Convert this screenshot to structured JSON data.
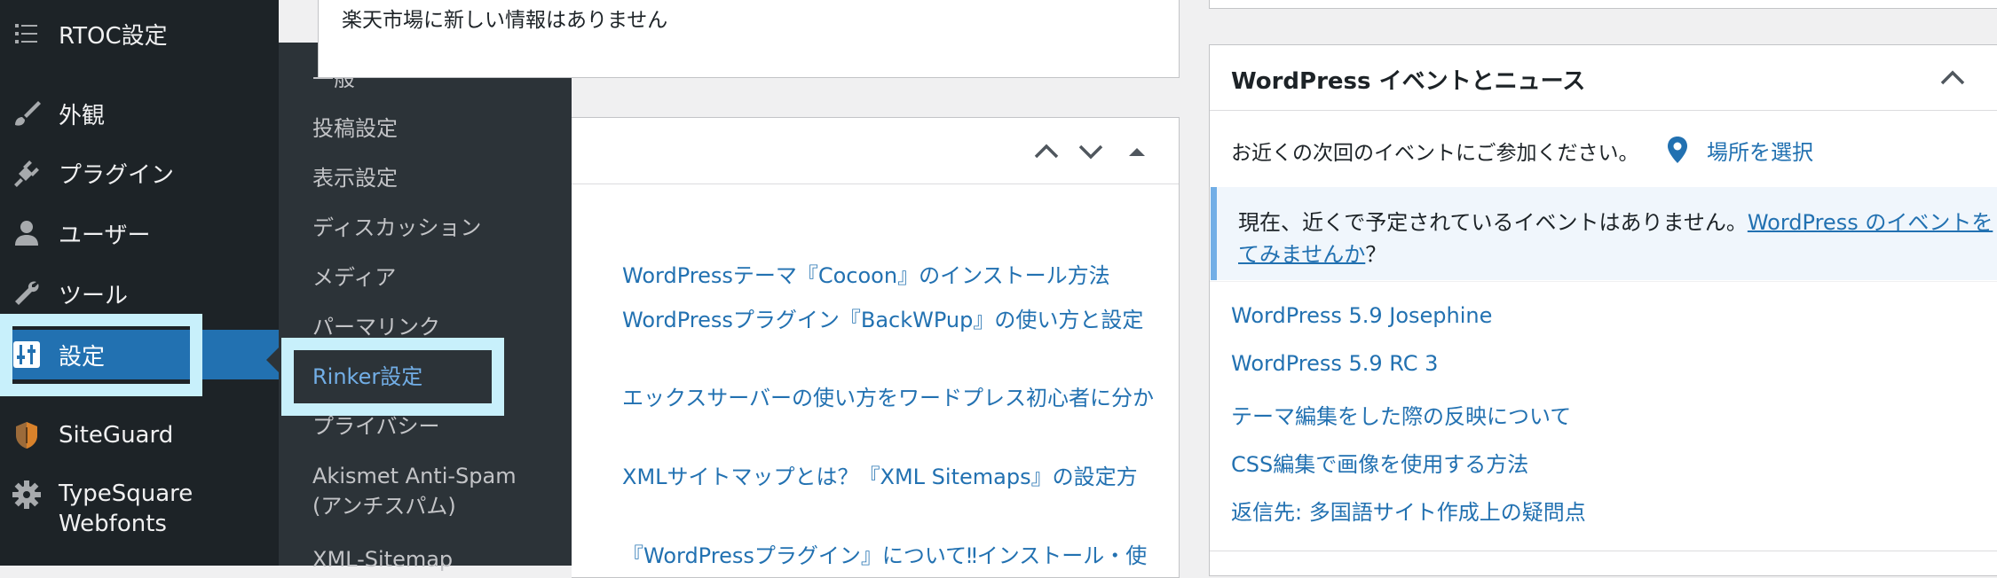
{
  "sidebar": {
    "items": [
      {
        "name": "rtoc",
        "label": "RTOC設定",
        "icon": "list-icon"
      },
      {
        "name": "appearance",
        "label": "外観",
        "icon": "paintbrush-icon"
      },
      {
        "name": "plugins",
        "label": "プラグイン",
        "icon": "plugin-icon"
      },
      {
        "name": "users",
        "label": "ユーザー",
        "icon": "user-icon"
      },
      {
        "name": "tools",
        "label": "ツール",
        "icon": "wrench-icon"
      },
      {
        "name": "settings",
        "label": "設定",
        "icon": "sliders-icon",
        "active": true
      },
      {
        "name": "siteguard",
        "label": "SiteGuard",
        "icon": "shield-icon"
      },
      {
        "name": "typesquare",
        "label": "TypeSquare Webfonts",
        "label_line1": "TypeSquare",
        "label_line2": "Webfonts",
        "icon": "gear-icon"
      }
    ]
  },
  "submenu": {
    "items": [
      {
        "label": "一般"
      },
      {
        "label": "投稿設定"
      },
      {
        "label": "表示設定"
      },
      {
        "label": "ディスカッション"
      },
      {
        "label": "メディア"
      },
      {
        "label": "パーマリンク"
      },
      {
        "label": "Rinker設定",
        "current": true
      },
      {
        "label": "プライバシー"
      },
      {
        "label": "Akismet Anti-Spam (アンチスパム)",
        "line1": "Akismet Anti-Spam",
        "line2": "(アンチスパム)"
      },
      {
        "label": "XML-Sitemap"
      }
    ]
  },
  "rakuten_panel": {
    "message": "楽天市場に新しい情報はありません"
  },
  "articles_panel": {
    "links": [
      "WordPressテーマ『Cocoon』のインストール方法",
      "WordPressプラグイン『BackWPup』の使い方と設定",
      "エックスサーバーの使い方をワードプレス初心者に分か",
      "XMLサイトマップとは？『XML Sitemaps』の設定方",
      "『WordPressプラグイン』について‼︎インストール・使"
    ]
  },
  "events_panel": {
    "title": "WordPress イベントとニュース",
    "intro": "お近くの次回のイベントにご参加ください。",
    "location_link": "場所を選択",
    "notice_text": "現在、近くで予定されているイベントはありません。",
    "notice_link_line1": "WordPress のイベントを",
    "notice_link_line2": "てみませんか",
    "notice_suffix": "？",
    "news": [
      "WordPress 5.9 Josephine",
      "WordPress 5.9 RC 3",
      "テーマ編集をした際の反映について",
      "CSS編集で画像を使用する方法",
      "返信先: 多国語サイト作成上の疑問点"
    ]
  },
  "colors": {
    "sidebar_bg": "#1d2327",
    "submenu_bg": "#2c3338",
    "accent": "#2271b1",
    "highlight": "#c8f0fb",
    "current_sub": "#72aee6"
  }
}
